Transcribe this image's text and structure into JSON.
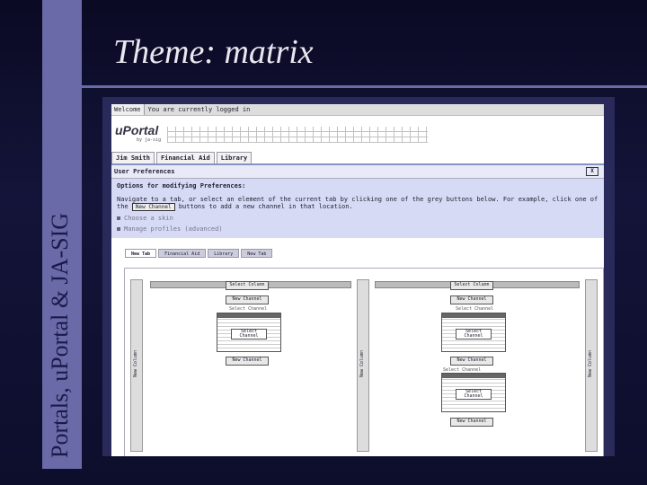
{
  "slide": {
    "title": "Theme: matrix",
    "vertical_title": "Portals, uPortal & JA-SIG",
    "accent": "#6a6aa8"
  },
  "app": {
    "welcome_tab": "Welcome",
    "logged_in": "You are currently logged in",
    "date": "",
    "logo": "uPortal",
    "logo_sub": "by ja-sig",
    "nav_tabs": [
      "Jim Smith",
      "Financial Aid",
      "Library"
    ],
    "prefs_title": "User Preferences",
    "close_label": "X",
    "options_heading": "Options for modifying Preferences:",
    "nav_text_1": "Navigate to a tab, or select an element of the current tab by clicking one of the grey buttons below. For example, click one of",
    "nav_text_2a": "the",
    "new_channel_btn": "New Channel",
    "nav_text_2b": "buttons to add a new channel in that location.",
    "option_skin": "Choose a skin",
    "option_profiles": "Manage profiles (advanced)",
    "sub_tabs": [
      "New Tab",
      "Financial Aid",
      "Library",
      "New Tab"
    ],
    "select_column": "Select Column",
    "new_column": "New Column",
    "new_channel": "New Channel",
    "channel_label": "Select Channel"
  }
}
